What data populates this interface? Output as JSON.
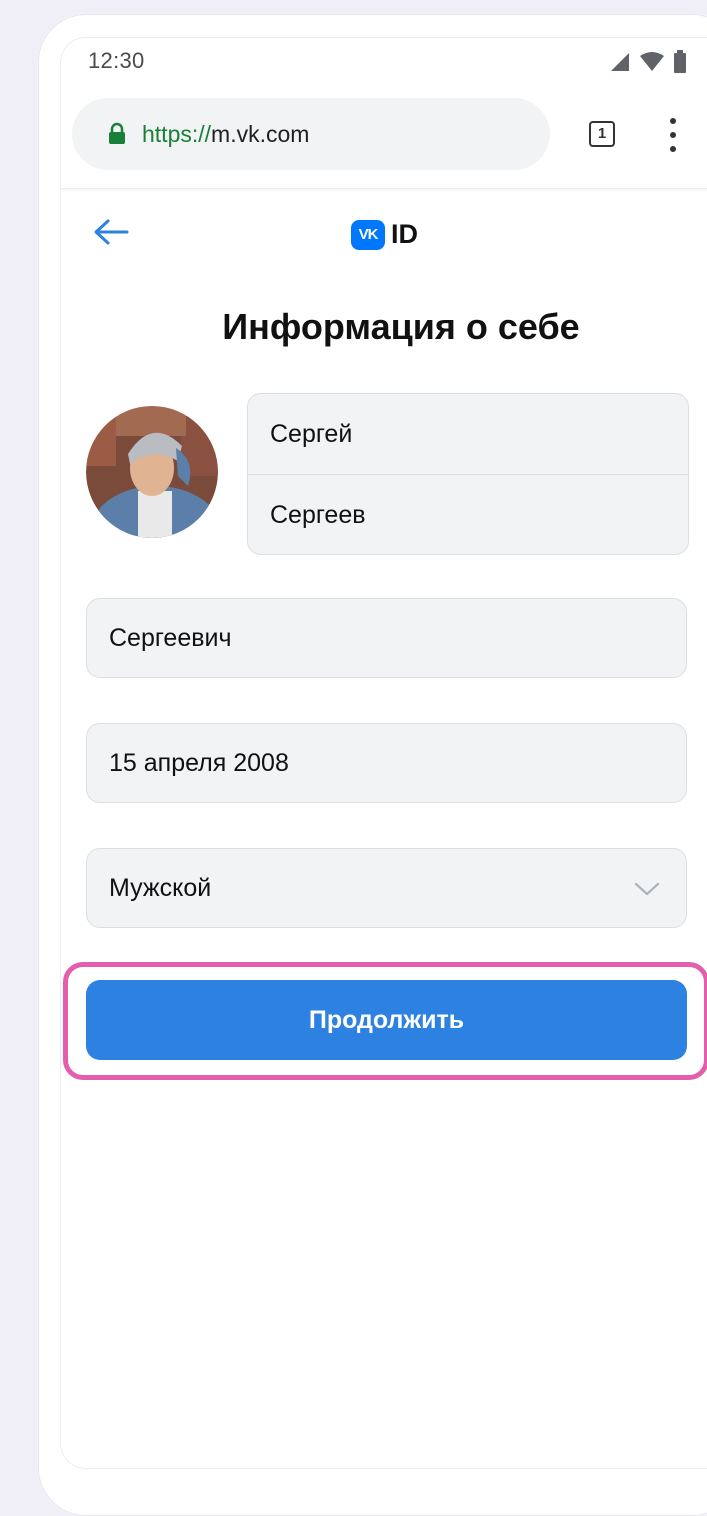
{
  "statusbar": {
    "time": "12:30",
    "icons": [
      "signal-icon",
      "wifi-icon",
      "battery-icon"
    ]
  },
  "browser": {
    "url_scheme": "https://",
    "url_host": "m.vk.com",
    "tab_count": "1",
    "icons": [
      "lock-icon",
      "menu-dots-icon"
    ],
    "url_color": "#188038"
  },
  "header": {
    "logo_badge": "VK",
    "logo_text": "ID",
    "back_icon": "arrow-left-icon",
    "accent_color": "#0077ff"
  },
  "page": {
    "title": "Информация о себе"
  },
  "form": {
    "first_name": "Сергей",
    "last_name": "Сергеев",
    "patronymic": "Сергеевич",
    "birth_date": "15 апреля 2008",
    "gender": "Мужской",
    "gender_icon": "chevron-down-icon",
    "continue_label": "Продолжить",
    "button_color": "#2d81e0",
    "highlight_color": "#e45fab"
  }
}
